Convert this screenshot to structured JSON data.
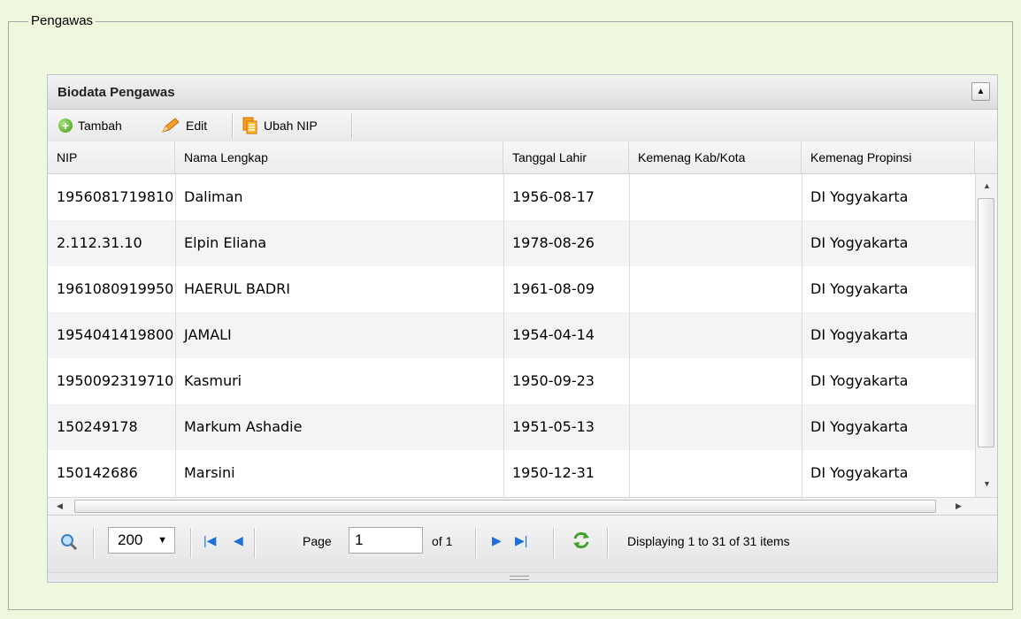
{
  "fieldset": {
    "legend": "Pengawas"
  },
  "panel": {
    "title": "Biodata Pengawas",
    "collapse_icon": "triangle-up-icon"
  },
  "toolbar": {
    "add_label": "Tambah",
    "edit_label": "Edit",
    "change_nip_label": "Ubah NIP"
  },
  "grid": {
    "columns": [
      "NIP",
      "Nama Lengkap",
      "Tanggal Lahir",
      "Kemenag Kab/Kota",
      "Kemenag Propinsi"
    ],
    "rows": [
      {
        "nip": "1956081719810",
        "nama": "Daliman",
        "tgl": "1956-08-17",
        "kab": "",
        "prop": "DI Yogyakarta"
      },
      {
        "nip": "2.112.31.10",
        "nama": "Elpin Eliana",
        "tgl": "1978-08-26",
        "kab": "",
        "prop": "DI Yogyakarta"
      },
      {
        "nip": "1961080919950",
        "nama": "HAERUL BADRI",
        "tgl": "1961-08-09",
        "kab": "",
        "prop": "DI Yogyakarta"
      },
      {
        "nip": "1954041419800",
        "nama": "JAMALI",
        "tgl": "1954-04-14",
        "kab": "",
        "prop": "DI Yogyakarta"
      },
      {
        "nip": "1950092319710",
        "nama": "Kasmuri",
        "tgl": "1950-09-23",
        "kab": "",
        "prop": "DI Yogyakarta"
      },
      {
        "nip": "150249178",
        "nama": "Markum Ashadie",
        "tgl": "1951-05-13",
        "kab": "",
        "prop": "DI Yogyakarta"
      },
      {
        "nip": "150142686",
        "nama": "Marsini",
        "tgl": "1950-12-31",
        "kab": "",
        "prop": "DI Yogyakarta"
      }
    ]
  },
  "pager": {
    "page_size": "200",
    "page_label": "Page",
    "page_value": "1",
    "of_label": "of 1",
    "status": "Displaying 1 to 31 of 31 items"
  },
  "colors": {
    "nav_blue": "#1f6fd6",
    "refresh_green": "#3ea02a"
  }
}
